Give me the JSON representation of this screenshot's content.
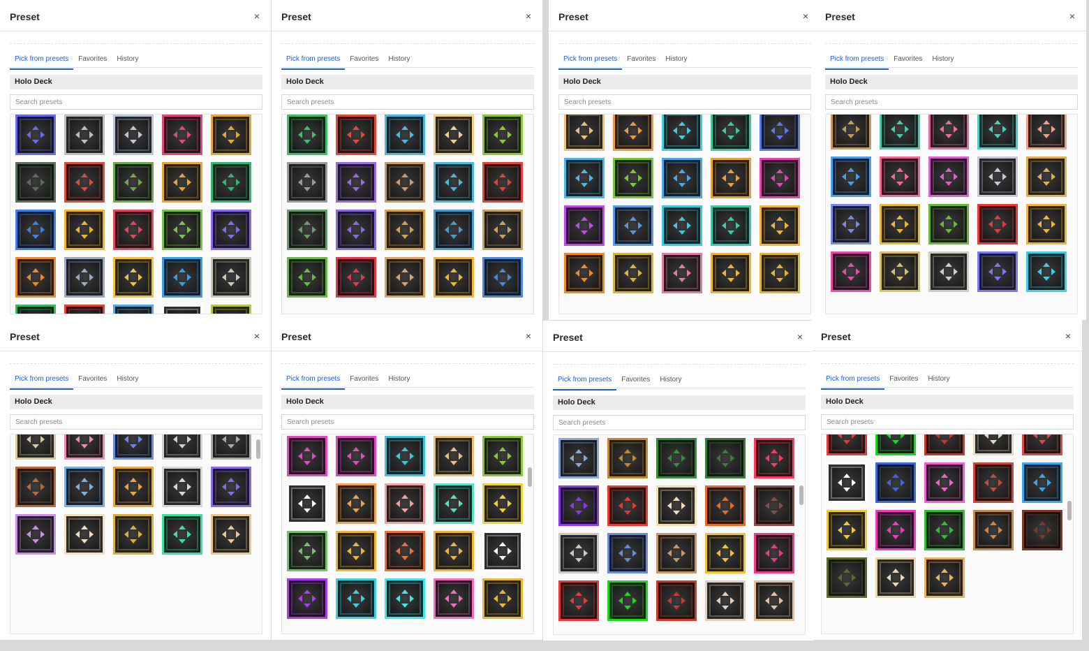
{
  "dialog": {
    "title": "Preset",
    "close_label": "×",
    "tabs": [
      "Pick from presets",
      "Favorites",
      "History"
    ],
    "active_tab": "Pick from presets",
    "section_title": "Holo Deck",
    "search_placeholder": "Search presets"
  },
  "panels": [
    {
      "colors": [
        "#6a6ae8",
        "#bdbdbd",
        "#bcc6d8",
        "#e0467a",
        "#e1a739",
        "#5e6e5e",
        "#d4503c",
        "#6fa84a",
        "#e8a43a",
        "#2fb774",
        "#3d7fe6",
        "#f0b429",
        "#e0465c",
        "#7cc24a",
        "#8a68ef",
        "#ef8a2a",
        "#9aa8c0",
        "#f0c43a",
        "#3aa0e6",
        "#c8c8b8",
        "#36b864",
        "#d8443a",
        "#58a8d8",
        "#ffffff",
        "#b8c83a"
      ]
    },
    {
      "colors": [
        "#3fbf6a",
        "#e04a3a",
        "#4ab8e0",
        "#f0d08a",
        "#8ac83a",
        "#9a9a9a",
        "#9a6ae0",
        "#c89a6a",
        "#4ab8d8",
        "#e0443a",
        "#6a9a6a",
        "#8a6ae0",
        "#d8a04a",
        "#4a9ad0",
        "#c8a06a",
        "#6ab84a",
        "#e03a4a",
        "#d8a46a",
        "#f0b43a",
        "#4a8ad8"
      ]
    },
    {
      "colors": [
        "#e8c07a",
        "#ef9a3a",
        "#3ad0e0",
        "#3ac8a0",
        "#5a7ae8",
        "#4ab8e8",
        "#7ac83a",
        "#4aa8e8",
        "#e8a03a",
        "#e04ab0",
        "#c04ae8",
        "#5a9ae0",
        "#3ac8e0",
        "#3ac8a8",
        "#f0b43a",
        "#ef8a2a",
        "#d8b43a",
        "#e07aa0",
        "#f0b43a",
        "#e0b43a"
      ]
    },
    {
      "colors": [
        "#c89a5a",
        "#4ac8b0",
        "#e86aa0",
        "#4ad0c0",
        "#f0a080",
        "#4aa0f0",
        "#f06a90",
        "#e060d0",
        "#c8c8d8",
        "#e0b050",
        "#7a8ae8",
        "#e8b83a",
        "#6ab83a",
        "#e83a3a",
        "#f0b43a",
        "#e84aa8",
        "#d8c06a",
        "#c8d0c0",
        "#7a7af0",
        "#3ad0e8"
      ]
    },
    {
      "colors": [
        "#d8c8a0",
        "#f08ab0",
        "#6a8ae8",
        "#d0d0d0",
        "#a8a8a8",
        "#b86a3a",
        "#7ab0e0",
        "#e8a83a",
        "#d8d8d8",
        "#8a6ae8",
        "#c890e8",
        "#f0e0c0",
        "#d8b040",
        "#3ae0a0",
        "#e8c890"
      ]
    },
    {
      "colors": [
        "#e04ac0",
        "#e04ac0",
        "#3ac8e0",
        "#e8c07a",
        "#8ac83a",
        "#ffffff",
        "#f0a050",
        "#f0a0a0",
        "#5ae0c0",
        "#f0d03a",
        "#78c070",
        "#f0b43a",
        "#f0703a",
        "#f0b43a",
        "#ffffff",
        "#b03af0",
        "#3ad0e0",
        "#3ae8f0",
        "#f070c0",
        "#e8b83a"
      ]
    },
    {
      "colors": [
        "#8aa8d8",
        "#c08a2a",
        "#3a8a3a",
        "#3a7a3a",
        "#ff3a5a",
        "#8a3ae8",
        "#e83a2a",
        "#f0e0b0",
        "#e86a2a",
        "#8a4a4a",
        "#c8c8c8",
        "#6a8ad8",
        "#c8986a",
        "#f0c03a",
        "#f03a8a",
        "#e83a3a",
        "#1ad81a",
        "#c83a2a",
        "#e0d0c0",
        "#e0c0a0"
      ]
    },
    {
      "colors": [
        "#e83a3a",
        "#1ad81a",
        "#c03a2a",
        "#e8d8c0",
        "#d84a4a",
        "#ffffff",
        "#3a6ad8",
        "#f060d0",
        "#c84a3a",
        "#3aa8f0",
        "#f0c83a",
        "#f03ac0",
        "#3ab83a",
        "#c8884a",
        "#7a3a2a",
        "#5a6a2a",
        "#e8d8b0",
        "#e8b060"
      ]
    }
  ]
}
